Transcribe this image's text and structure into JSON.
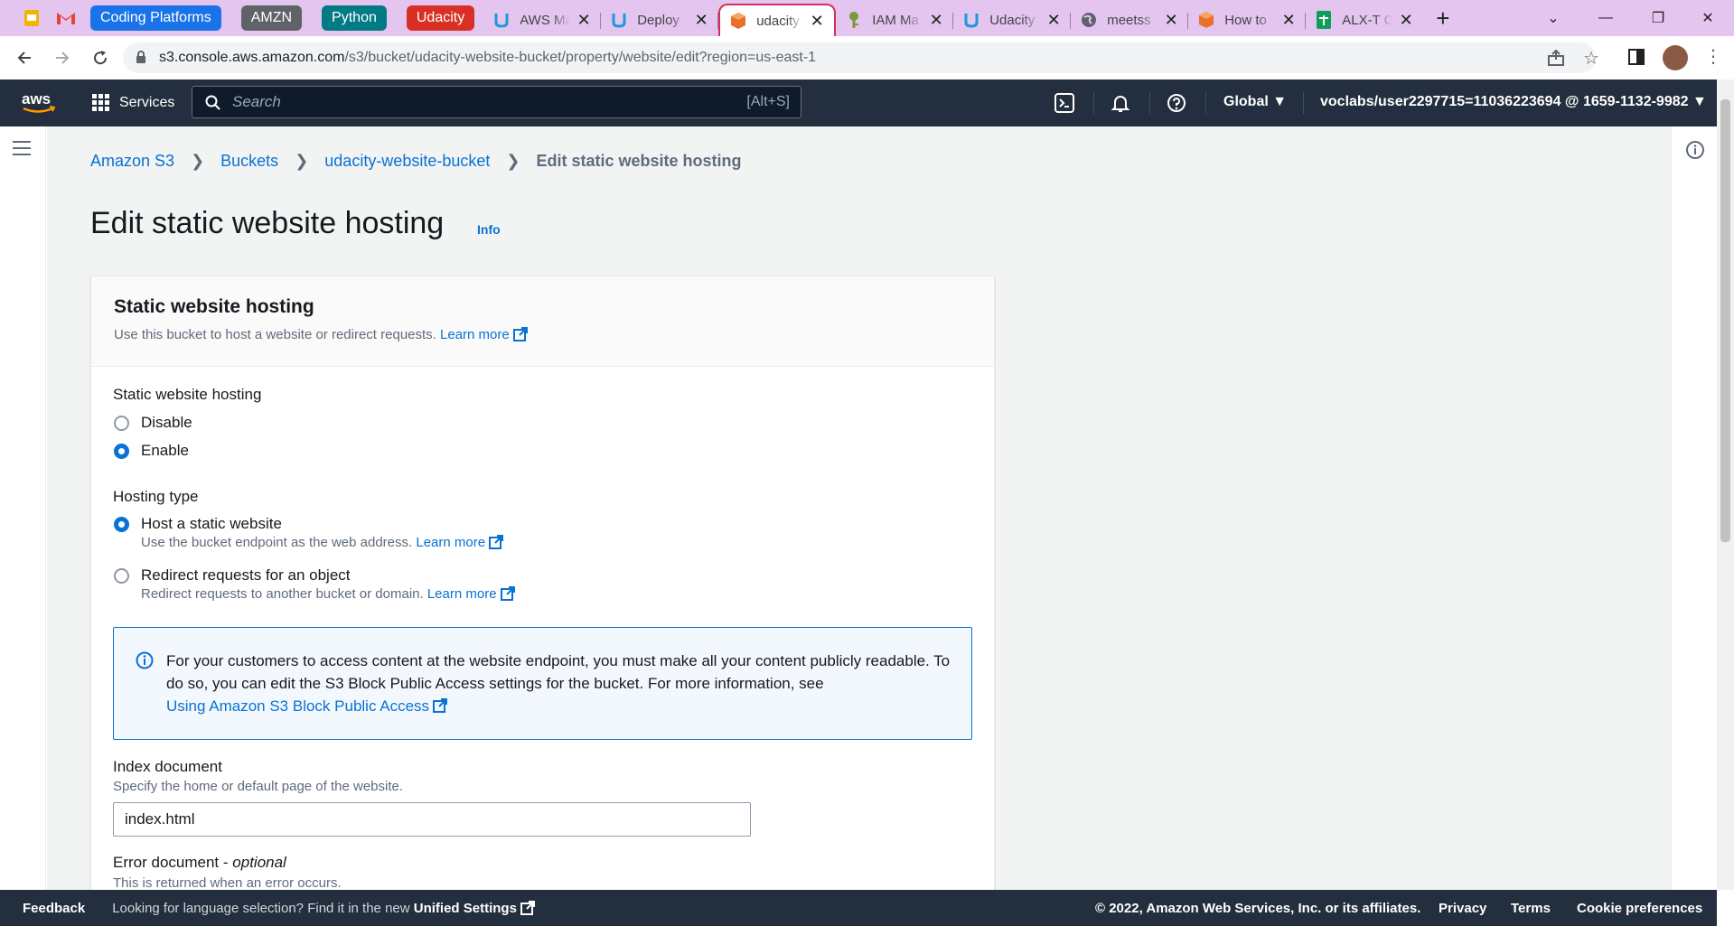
{
  "browser": {
    "pills": [
      {
        "label": "Coding Platforms",
        "color": "#1a73e8"
      },
      {
        "label": "AMZN",
        "color": "#5f6368"
      },
      {
        "label": "Python",
        "color": "#007b83"
      },
      {
        "label": "Udacity",
        "color": "#d93025"
      }
    ],
    "tabs": [
      {
        "label": "AWS Ma",
        "icon": "udacity-icon"
      },
      {
        "label": "Deploy",
        "icon": "udacity-icon"
      },
      {
        "label": "udacity",
        "icon": "aws-s3-icon",
        "active": true
      },
      {
        "label": "IAM Ma",
        "icon": "key-icon"
      },
      {
        "label": "Udacity",
        "icon": "udacity-icon"
      },
      {
        "label": "meetss",
        "icon": "globe-icon"
      },
      {
        "label": "How to",
        "icon": "aws-s3-icon"
      },
      {
        "label": "ALX-T C",
        "icon": "sheets-icon"
      }
    ],
    "url_host": "s3.console.aws.amazon.com",
    "url_path": "/s3/bucket/udacity-website-bucket/property/website/edit?region=us-east-1"
  },
  "aws_nav": {
    "services_label": "Services",
    "search_placeholder": "Search",
    "search_shortcut": "[Alt+S]",
    "region": "Global",
    "account": "voclabs/user2297715=11036223694 @ 1659-1132-9982"
  },
  "breadcrumb": {
    "items": [
      "Amazon S3",
      "Buckets",
      "udacity-website-bucket"
    ],
    "current": "Edit static website hosting"
  },
  "page": {
    "title": "Edit static website hosting",
    "info_label": "Info"
  },
  "panel": {
    "title": "Static website hosting",
    "desc": "Use this bucket to host a website or redirect requests.",
    "learn_more": "Learn more",
    "hosting_label": "Static website hosting",
    "hosting_options": [
      "Disable",
      "Enable"
    ],
    "hosting_selected": "Enable",
    "type_label": "Hosting type",
    "type_options": [
      {
        "label": "Host a static website",
        "desc": "Use the bucket endpoint as the web address."
      },
      {
        "label": "Redirect requests for an object",
        "desc": "Redirect requests to another bucket or domain."
      }
    ],
    "type_selected": "Host a static website",
    "alert_text": "For your customers to access content at the website endpoint, you must make all your content publicly readable. To do so, you can edit the S3 Block Public Access settings for the bucket. For more information, see",
    "alert_link": "Using Amazon S3 Block Public Access",
    "index_label": "Index document",
    "index_desc": "Specify the home or default page of the website.",
    "index_value": "index.html",
    "error_label": "Error document -",
    "error_optional": "optional",
    "error_desc": "This is returned when an error occurs."
  },
  "footer": {
    "feedback": "Feedback",
    "lang_text": "Looking for language selection? Find it in the new",
    "lang_link": "Unified Settings",
    "copyright": "© 2022, Amazon Web Services, Inc. or its affiliates.",
    "privacy": "Privacy",
    "terms": "Terms",
    "cookies": "Cookie preferences"
  }
}
